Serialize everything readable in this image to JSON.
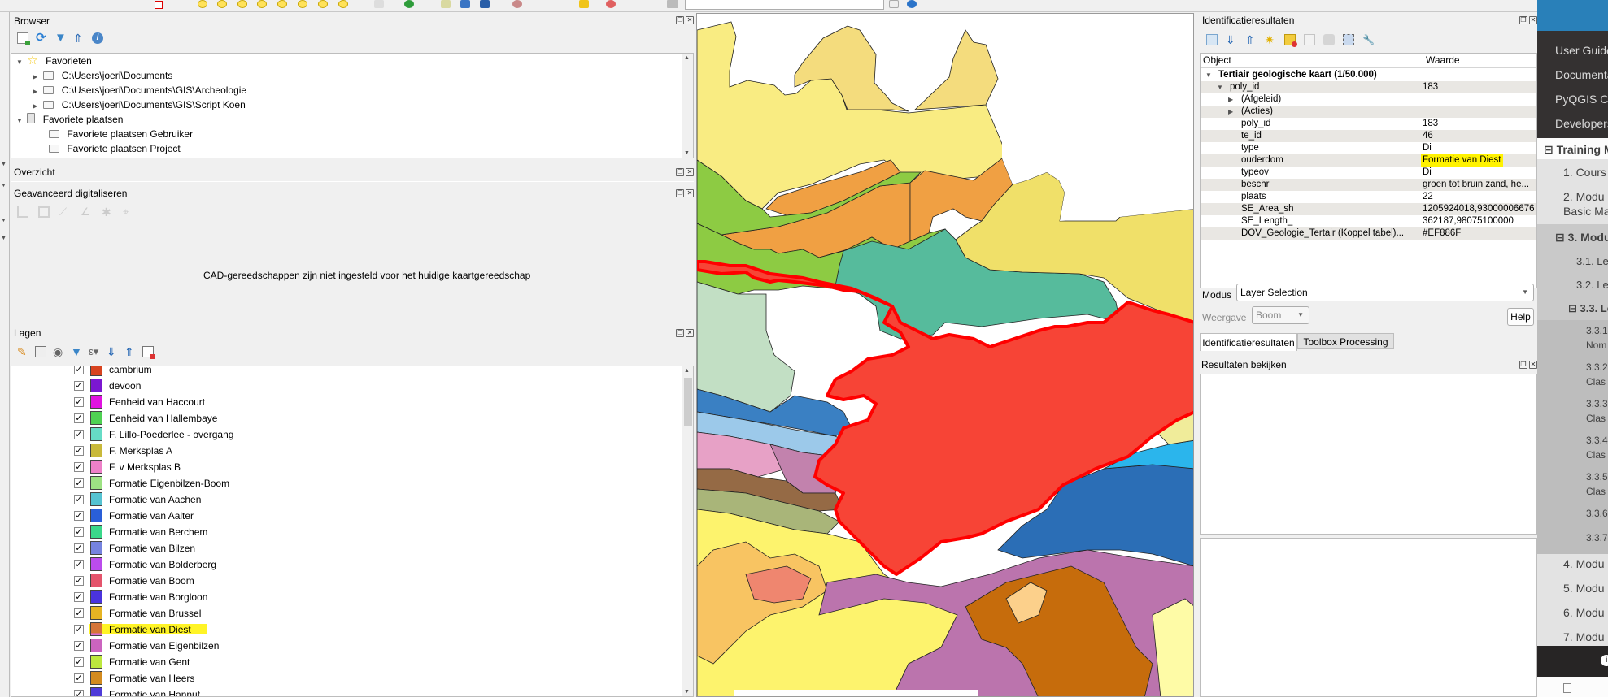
{
  "topbar": {
    "search_value": ""
  },
  "browser": {
    "title": "Browser",
    "toolbar_icons": [
      "add-layer-icon",
      "refresh-icon",
      "filter-icon",
      "collapse-all-icon",
      "info-icon"
    ],
    "tree": [
      {
        "label": "Favorieten",
        "icon": "star-icon",
        "level": 0,
        "expanded": true
      },
      {
        "label": "C:\\Users\\joeri\\Documents",
        "icon": "folder-icon",
        "level": 1,
        "expanded": false
      },
      {
        "label": "C:\\Users\\joeri\\Documents\\GIS\\Archeologie",
        "icon": "folder-icon",
        "level": 1,
        "expanded": false
      },
      {
        "label": "C:\\Users\\joeri\\Documents\\GIS\\Script Koen",
        "icon": "folder-icon",
        "level": 1,
        "expanded": false
      },
      {
        "label": "Favoriete plaatsen",
        "icon": "bookmark-icon",
        "level": 0,
        "expanded": true
      },
      {
        "label": "Favoriete plaatsen Gebruiker",
        "icon": "folder-icon",
        "level": 1
      },
      {
        "label": "Favoriete plaatsen Project",
        "icon": "folder-icon",
        "level": 1
      }
    ]
  },
  "overview": {
    "title": "Overzicht"
  },
  "advanced_digitizing": {
    "title": "Geavanceerd digitaliseren",
    "message": "CAD-gereedschappen zijn niet ingesteld voor het huidige kaartgereedschap"
  },
  "layers": {
    "title": "Lagen",
    "items": [
      {
        "name": "cambrium",
        "color": "#d8431f",
        "checked": true
      },
      {
        "name": "devoon",
        "color": "#7b17d0",
        "checked": true
      },
      {
        "name": "Eenheid van Haccourt",
        "color": "#e012e0",
        "checked": true
      },
      {
        "name": "Eenheid van Hallembaye",
        "color": "#4fd153",
        "checked": true
      },
      {
        "name": "F. Lillo-Poederlee - overgang",
        "color": "#66dcc6",
        "checked": true
      },
      {
        "name": "F. Merksplas A",
        "color": "#c9b93a",
        "checked": true
      },
      {
        "name": "F. v Merksplas B",
        "color": "#ee80c8",
        "checked": true
      },
      {
        "name": "Formatie Eigenbilzen-Boom",
        "color": "#9de283",
        "checked": true
      },
      {
        "name": "Formatie van Aachen",
        "color": "#55c3d2",
        "checked": true
      },
      {
        "name": "Formatie van Aalter",
        "color": "#2a5fd8",
        "checked": true
      },
      {
        "name": "Formatie van Berchem",
        "color": "#3ad88a",
        "checked": true
      },
      {
        "name": "Formatie van Bilzen",
        "color": "#7683df",
        "checked": true
      },
      {
        "name": "Formatie van Bolderberg",
        "color": "#bb4cec",
        "checked": true
      },
      {
        "name": "Formatie van Boom",
        "color": "#e4546c",
        "checked": true
      },
      {
        "name": "Formatie van Borgloon",
        "color": "#4a33de",
        "checked": true
      },
      {
        "name": "Formatie van Brussel",
        "color": "#e6b423",
        "checked": true
      },
      {
        "name": "Formatie van Diest",
        "color": "#d76cd6",
        "checked": true,
        "highlighted": true
      },
      {
        "name": "Formatie van Eigenbilzen",
        "color": "#cb64bf",
        "checked": true
      },
      {
        "name": "Formatie van Gent",
        "color": "#bde83e",
        "checked": true
      },
      {
        "name": "Formatie van Heers",
        "color": "#d38b1e",
        "checked": true
      },
      {
        "name": "Formatie van Hannut",
        "color": "#4e3bd8",
        "checked": true
      }
    ]
  },
  "identify": {
    "title": "Identificatieresultaten",
    "columns": {
      "object": "Object",
      "value": "Waarde"
    },
    "rows": [
      {
        "key": "Tertiair geologische kaart (1/50.000)",
        "value": "",
        "level": 0,
        "bold": true,
        "expander": "open"
      },
      {
        "key": "poly_id",
        "value": "183",
        "level": 1,
        "expander": "open"
      },
      {
        "key": "(Afgeleid)",
        "value": "",
        "level": 2,
        "expander": "closed"
      },
      {
        "key": "(Acties)",
        "value": "",
        "level": 2,
        "expander": "closed"
      },
      {
        "key": "poly_id",
        "value": "183",
        "level": 2
      },
      {
        "key": "te_id",
        "value": "46",
        "level": 2
      },
      {
        "key": "type",
        "value": "Di",
        "level": 2
      },
      {
        "key": "ouderdom",
        "value": "Formatie van Diest",
        "level": 2,
        "highlighted": true
      },
      {
        "key": "typeov",
        "value": "Di",
        "level": 2
      },
      {
        "key": "beschr",
        "value": "groen tot bruin zand, he...",
        "level": 2
      },
      {
        "key": "plaats",
        "value": "22",
        "level": 2
      },
      {
        "key": "SE_Area_sh",
        "value": "1205924018,93000006676",
        "level": 2
      },
      {
        "key": "SE_Length_",
        "value": "362187,98075100000",
        "level": 2
      },
      {
        "key": "DOV_Geologie_Tertair (Koppel tabel)...",
        "value": "#EF886F",
        "level": 2
      }
    ],
    "mode_label": "Modus",
    "mode_value": "Layer Selection",
    "view_label": "Weergave",
    "view_value": "Boom",
    "help_label": "Help",
    "tabs": [
      {
        "label": "Identificatieresultaten",
        "active": true
      },
      {
        "label": "Toolbox Processing",
        "active": false
      }
    ]
  },
  "results_viewer": {
    "title": "Resultaten bekijken"
  },
  "doc_sidebar": {
    "top_links": [
      "User Guide",
      "Documentation",
      "PyQGIS Cookbook",
      "Developers"
    ],
    "toc": [
      {
        "label": "⊟ Training M",
        "level": 0,
        "bold": true
      },
      {
        "label": "1. Cours",
        "level": 1
      },
      {
        "label": "2. Modu",
        "label2": "Basic Ma",
        "level": 1
      },
      {
        "label": "⊟ 3. Modu",
        "level": 1,
        "bold": true
      },
      {
        "label": "3.1. Le",
        "level": 2
      },
      {
        "label": "3.2. Le",
        "level": 2
      },
      {
        "label": "⊟ 3.3. Le",
        "level": 2,
        "bold": true
      },
      {
        "label": "3.3.1",
        "label2": "Nom",
        "level": 3
      },
      {
        "label": "3.3.2",
        "label2": "Clas",
        "level": 3
      },
      {
        "label": "3.3.3",
        "label2": "Clas",
        "level": 3
      },
      {
        "label": "3.3.4",
        "label2": "Clas",
        "level": 3
      },
      {
        "label": "3.3.5",
        "label2": "Clas",
        "level": 3
      },
      {
        "label": "3.3.6",
        "level": 3
      },
      {
        "label": "3.3.7",
        "level": 3
      },
      {
        "label": "4. Modu",
        "level": 1
      },
      {
        "label": "5. Modu",
        "level": 1
      },
      {
        "label": "6. Modu",
        "level": 1
      },
      {
        "label": "7. Modu",
        "level": 1
      }
    ],
    "footer_icon": "info-icon"
  },
  "colors": {
    "selection_outline": "#ff0000",
    "selected_fill": "#f74436",
    "highlight": "#fff200",
    "doc_header": "#2980b9",
    "doc_dark": "#343131"
  }
}
